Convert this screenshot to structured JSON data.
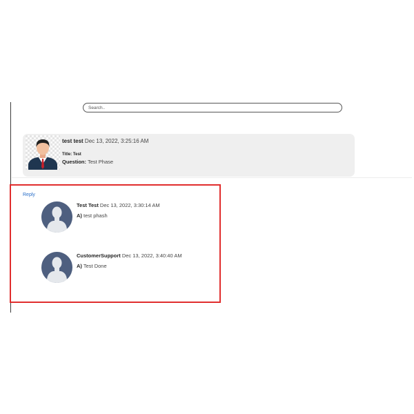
{
  "search": {
    "placeholder": "Search.."
  },
  "question": {
    "author": "test test",
    "timestamp": "Dec 13, 2022, 3:25:16 AM",
    "title_label": "Title:",
    "title_value": "Test",
    "question_label": "Question:",
    "question_value": "Test Phase"
  },
  "reply_link": "Reply",
  "answers": [
    {
      "author": "Test Test",
      "timestamp": "Dec 13, 2022, 3:30:14 AM",
      "prefix": "A)",
      "text": "test phash"
    },
    {
      "author": "CustomerSupport",
      "timestamp": "Dec 13, 2022, 3:40:40 AM",
      "prefix": "A)",
      "text": "Test Done"
    }
  ],
  "colors": {
    "highlight_border": "#e02c2c",
    "link": "#2a6fc9",
    "card_bg": "#efefef"
  }
}
